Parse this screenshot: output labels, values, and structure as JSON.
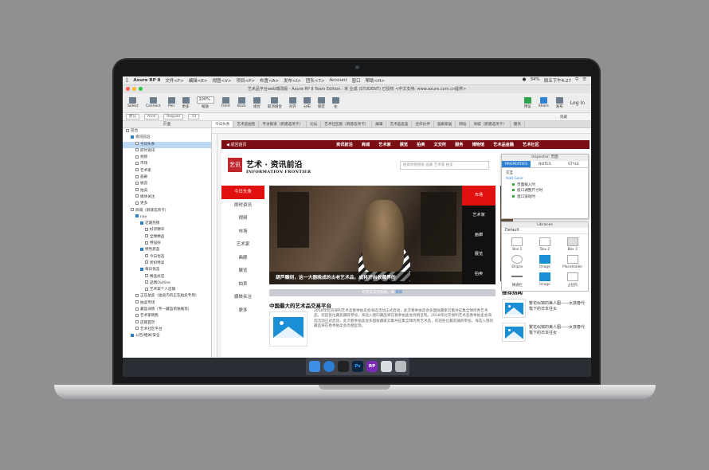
{
  "menubar": {
    "app": "Axure RP 8",
    "items": [
      "文件<F>",
      "编辑<E>",
      "视图<V>",
      "项目<P>",
      "布置<A>",
      "发布<I>",
      "团队<T>",
      "Account",
      "窗口",
      "帮助<H>"
    ],
    "battery": "34%",
    "clock": "周五下午4:27"
  },
  "window": {
    "title": "艺术品平台web端改版 - Axure RP 8 Team Edition : 米 业成 (STUDENT) 已授权   <中文支持: www.axure.com.cn提供>"
  },
  "toolbar": {
    "buttons": [
      "Select",
      "Connect",
      "Pen",
      "更多"
    ],
    "zoom": "100%",
    "zoom_label": "缩放",
    "arrange": [
      "Front",
      "Back",
      "组合",
      "取消组合",
      "对齐",
      "分布",
      "锁定",
      "左"
    ],
    "right": [
      "预览",
      "Share",
      "发布"
    ],
    "login": "Log In"
  },
  "stylebar": {
    "style": "默认",
    "font": "Arial",
    "weight": "Regular",
    "size": "13",
    "hidden": "隐藏"
  },
  "pages": {
    "header": "页面",
    "items": [
      {
        "label": "前台",
        "level": 0,
        "type": "page"
      },
      {
        "label": "资讯前沿",
        "level": 1,
        "type": "folder"
      },
      {
        "label": "今日头条",
        "level": 2,
        "type": "page",
        "selected": true
      },
      {
        "label": "即时资讯",
        "level": 2,
        "type": "page"
      },
      {
        "label": "视频",
        "level": 2,
        "type": "page"
      },
      {
        "label": "市场",
        "level": 2,
        "type": "page"
      },
      {
        "label": "艺术家",
        "level": 2,
        "type": "page"
      },
      {
        "label": "画廊",
        "level": 2,
        "type": "page"
      },
      {
        "label": "展览",
        "level": 2,
        "type": "page"
      },
      {
        "label": "拍卖",
        "level": 2,
        "type": "page"
      },
      {
        "label": "媒体关注",
        "level": 2,
        "type": "page"
      },
      {
        "label": "更多",
        "level": 2,
        "type": "page"
      },
      {
        "label": "商城（新建选项卡）",
        "level": 1,
        "type": "page"
      },
      {
        "label": "nav",
        "level": 2,
        "type": "folder"
      },
      {
        "label": "近期热销",
        "level": 3,
        "type": "folder"
      },
      {
        "label": "好货精华",
        "level": 4,
        "type": "page"
      },
      {
        "label": "全球精品",
        "level": 4,
        "type": "page"
      },
      {
        "label": "特设好",
        "level": 4,
        "type": "page"
      },
      {
        "label": "特色新品",
        "level": 3,
        "type": "folder"
      },
      {
        "label": "今日优选",
        "level": 4,
        "type": "page"
      },
      {
        "label": "折扣特卖",
        "level": 4,
        "type": "page"
      },
      {
        "label": "每日优选",
        "level": 3,
        "type": "folder"
      },
      {
        "label": "精品好店",
        "level": 4,
        "type": "page"
      },
      {
        "label": "品牌Outline",
        "level": 4,
        "type": "page"
      },
      {
        "label": "艺术家个人店铺",
        "level": 4,
        "type": "page"
      },
      {
        "label": "正在拍卖（拍卖内的正在拍卖专场）",
        "level": 2,
        "type": "page"
      },
      {
        "label": "拍卖专场",
        "level": 2,
        "type": "page"
      },
      {
        "label": "藏品详情（专一藏品单独展现）",
        "level": 2,
        "type": "page"
      },
      {
        "label": "艺术家销售",
        "level": 2,
        "type": "page"
      },
      {
        "label": "店铺首页",
        "level": 2,
        "type": "page"
      },
      {
        "label": "艺术社区平台",
        "level": 2,
        "type": "page"
      },
      {
        "label": "公告/相关/安全",
        "level": 1,
        "type": "folder"
      }
    ]
  },
  "tabs": [
    "今日头条",
    "艺术品拍售",
    "专访报道（新建选项卡）",
    "论坛",
    "艺术社区版（新建选项卡）",
    "编辑",
    "艺术品品鉴",
    "合作伙伴",
    "画廊家居",
    "网站",
    "商城（新建选项卡）",
    "服务"
  ],
  "site": {
    "back": "返回首页",
    "nav": [
      "资讯前沿",
      "商城",
      "艺术家",
      "展览",
      "拍卖",
      "文交所",
      "服务",
      "博物馆",
      "艺术品金融",
      "艺术社区"
    ],
    "logo_text": "艺讯",
    "brand_cn": "艺术 · 资讯前沿",
    "brand_en": "INFORMATION FRONTIER",
    "search_placeholder": "搜索你想搜索 画廊 艺术家 拍卖",
    "left_menu": [
      "今日头条",
      "即时资讯",
      "视频",
      "市场",
      "艺术家",
      "画廊",
      "展览",
      "拍卖",
      "媒体关注",
      "更多"
    ],
    "hero_caption": "葫芦雕刻，这一大器晚成的古老艺术品，或将开启收藏界的",
    "hero_tabs": [
      "市场",
      "艺术家",
      "画廊",
      "展览",
      "拍卖"
    ],
    "notice": "您有未读的新闻，请",
    "notice_link": "刷新",
    "section_title": "中国最大的艺术品交易平台",
    "article": "2018年北京保利艺术品春季拍卖会海选活动正式启动，此次春季拍卖会多国收藏家云集共征集全球优秀艺术品，欢迎各位藏友踊跃参加，海选入围的藏品将在春季拍卖会亮相呈现。2018年北京保利艺术品春季拍卖会海选活动正式启动，此次春季拍卖会多国收藏家云集共征集全球优秀艺术品，欢迎各位藏友踊跃参加，海选入围的藏品将在春季拍卖会亮相呈现。",
    "rec_title": "推荐热闻",
    "rec_items": [
      "繁花似锦的美人图——女孩春代笔下的日本往女",
      "繁花似锦的美人图——女孩春代笔下的日本往女"
    ]
  },
  "inspector": {
    "title": "Inspector: 页面",
    "tabs": [
      "PROPERTIES",
      "NOTES",
      "STYLE"
    ],
    "section": "交互",
    "add_case": "Add Case",
    "events": [
      "页面载入时",
      "窗口调整尺寸时",
      "窗口滚动时"
    ]
  },
  "libraries": {
    "title": "Libraries",
    "selected": "Default",
    "items": [
      "Box 1",
      "Box 2",
      "Box 3",
      "Ellipse",
      "Image",
      "Placeholder",
      "横道栏",
      "Image",
      "占位符"
    ]
  },
  "colors": {
    "nav_bg": "#7a0e14",
    "accent_red": "#e0100f",
    "link_blue": "#2f7fd4",
    "placeholder_blue": "#1a8fd6"
  },
  "dock": [
    "finder-icon",
    "safari-icon",
    "qq-icon",
    "photoshop-icon",
    "axure-icon",
    "messages-icon",
    "trash-icon"
  ]
}
